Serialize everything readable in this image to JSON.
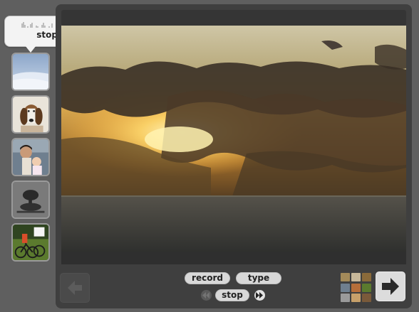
{
  "tooltip": {
    "label": "stop"
  },
  "thumbnails": [
    {
      "name": "snow-slope"
    },
    {
      "name": "basset-hound"
    },
    {
      "name": "man-with-baby"
    },
    {
      "name": "tree-silhouette"
    },
    {
      "name": "cyclists"
    }
  ],
  "main_image": {
    "name": "sunset-over-sea"
  },
  "controls": {
    "record_label": "record",
    "type_label": "type",
    "stop_label": "stop"
  },
  "icons": {
    "prev": "arrow-left-icon",
    "next": "arrow-right-icon",
    "grid": "thumbnail-grid-icon",
    "rewind": "rewind-icon",
    "fast_forward": "fast-forward-icon"
  },
  "colors": {
    "background": "#5f5f5f",
    "panel": "#3f3f3f",
    "button": "#d8d8d8"
  }
}
